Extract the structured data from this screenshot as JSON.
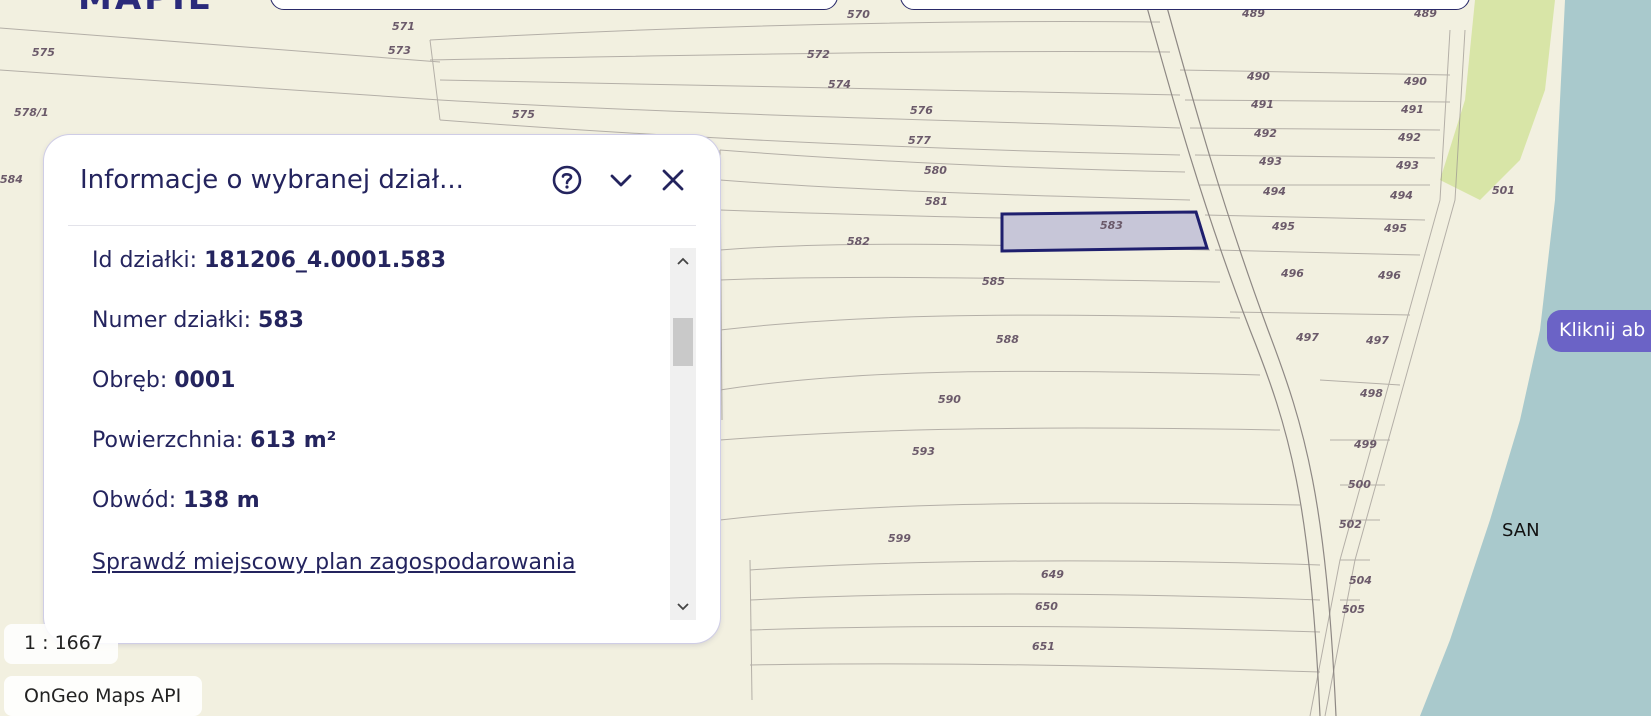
{
  "header": {
    "logo_text": "MAPIE"
  },
  "map": {
    "parcel_labels": [
      "571",
      "575",
      "573",
      "570",
      "572",
      "574",
      "578/1",
      "575",
      "576",
      "577",
      "584",
      "580",
      "581",
      "582",
      "583",
      "585",
      "588",
      "590",
      "593",
      "599",
      "649",
      "650",
      "651",
      "489",
      "489",
      "490",
      "490",
      "491",
      "491",
      "492",
      "492",
      "493",
      "493",
      "494",
      "494",
      "495",
      "495",
      "496",
      "496",
      "497",
      "497",
      "498",
      "499",
      "500",
      "501",
      "502",
      "504",
      "505"
    ],
    "selected_parcel": "583",
    "river_label": "SAN",
    "colors": {
      "background": "#f2f0e0",
      "river": "#a9c9cc",
      "selection_fill": "#c7c6d8",
      "selection_stroke": "#1f1f6e",
      "vegetation": "#d3e39c"
    }
  },
  "panel": {
    "title": "Informacje o wybranej dział...",
    "help_icon": "help-circle-icon",
    "collapse_icon": "chevron-down-icon",
    "close_icon": "close-icon",
    "rows": [
      {
        "label": "Id działki:",
        "value": "181206_4.0001.583"
      },
      {
        "label": "Numer działki:",
        "value": "583"
      },
      {
        "label": "Obręb:",
        "value": "0001"
      },
      {
        "label": "Powierzchnia:",
        "value": "613 m²"
      },
      {
        "label": "Obwód:",
        "value": "138 m"
      }
    ],
    "link_text": "Sprawdź miejscowy plan zagospodarowania"
  },
  "scale_text": "1 : 1667",
  "attribution": "OnGeo Maps API",
  "tooltip_text": "Kliknij ab"
}
